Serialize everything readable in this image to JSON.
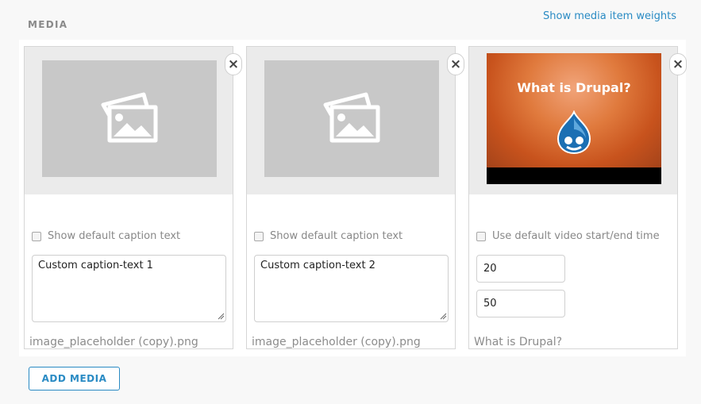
{
  "section": {
    "title": "MEDIA",
    "weights_link": "Show media item weights"
  },
  "items": [
    {
      "type": "image",
      "thumbnail_icon": "image-placeholder-icon",
      "remove_label": "×",
      "checkbox_label": "Show default caption text",
      "checkbox_checked": false,
      "caption": "Custom caption-text 1",
      "filename": "image_placeholder (copy).png"
    },
    {
      "type": "image",
      "thumbnail_icon": "image-placeholder-icon",
      "remove_label": "×",
      "checkbox_label": "Show default caption text",
      "checkbox_checked": false,
      "caption": "Custom caption-text 2",
      "filename": "image_placeholder (copy).png"
    },
    {
      "type": "video",
      "thumbnail_title": "What is Drupal?",
      "thumbnail_icon": "drupal-drop-logo",
      "remove_label": "×",
      "checkbox_label": "Use default video start/end time",
      "checkbox_checked": false,
      "start_time": "20",
      "end_time": "50",
      "filename": "What is Drupal?"
    }
  ],
  "actions": {
    "add_media": "ADD MEDIA"
  },
  "colors": {
    "accent": "#2a8bc4",
    "placeholder_bg": "#c8c8c8",
    "thumb_bg": "#ebebeb"
  }
}
